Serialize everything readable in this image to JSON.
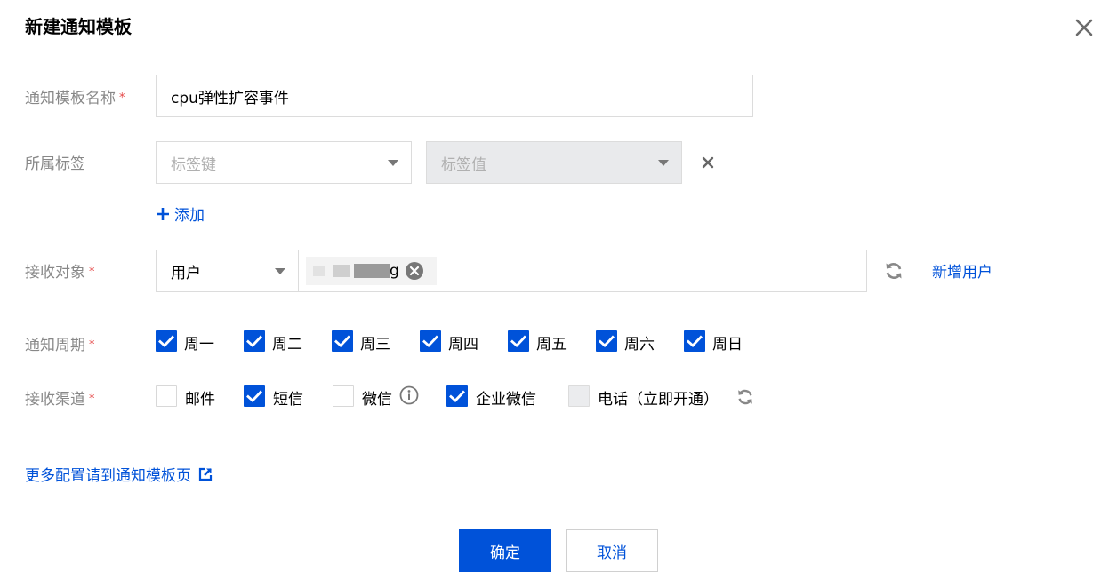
{
  "dialog": {
    "title": "新建通知模板",
    "close_icon": "close-icon"
  },
  "form": {
    "template_name": {
      "label": "通知模板名称",
      "required_mark": "*",
      "value": "cpu弹性扩容事件"
    },
    "tags": {
      "label": "所属标签",
      "key_placeholder": "标签键",
      "value_placeholder": "标签值",
      "add_label": "添加"
    },
    "recipients": {
      "label": "接收对象",
      "required_mark": "*",
      "type_value": "用户",
      "selected_user_suffix": "g",
      "add_user_label": "新增用户"
    },
    "period": {
      "label": "通知周期",
      "required_mark": "*",
      "days": [
        {
          "label": "周一",
          "checked": true
        },
        {
          "label": "周二",
          "checked": true
        },
        {
          "label": "周三",
          "checked": true
        },
        {
          "label": "周四",
          "checked": true
        },
        {
          "label": "周五",
          "checked": true
        },
        {
          "label": "周六",
          "checked": true
        },
        {
          "label": "周日",
          "checked": true
        }
      ]
    },
    "channels": {
      "label": "接收渠道",
      "required_mark": "*",
      "items": [
        {
          "label": "邮件",
          "checked": false
        },
        {
          "label": "短信",
          "checked": true
        },
        {
          "label": "微信",
          "checked": false
        },
        {
          "label": "企业微信",
          "checked": true
        },
        {
          "label": "电话（立即开通）",
          "checked": false,
          "disabled": true
        }
      ]
    },
    "more_config_link": "更多配置请到通知模板页"
  },
  "footer": {
    "confirm_label": "确定",
    "cancel_label": "取消"
  },
  "colors": {
    "primary": "#0052d9",
    "label": "#888888",
    "required": "#e54545"
  }
}
